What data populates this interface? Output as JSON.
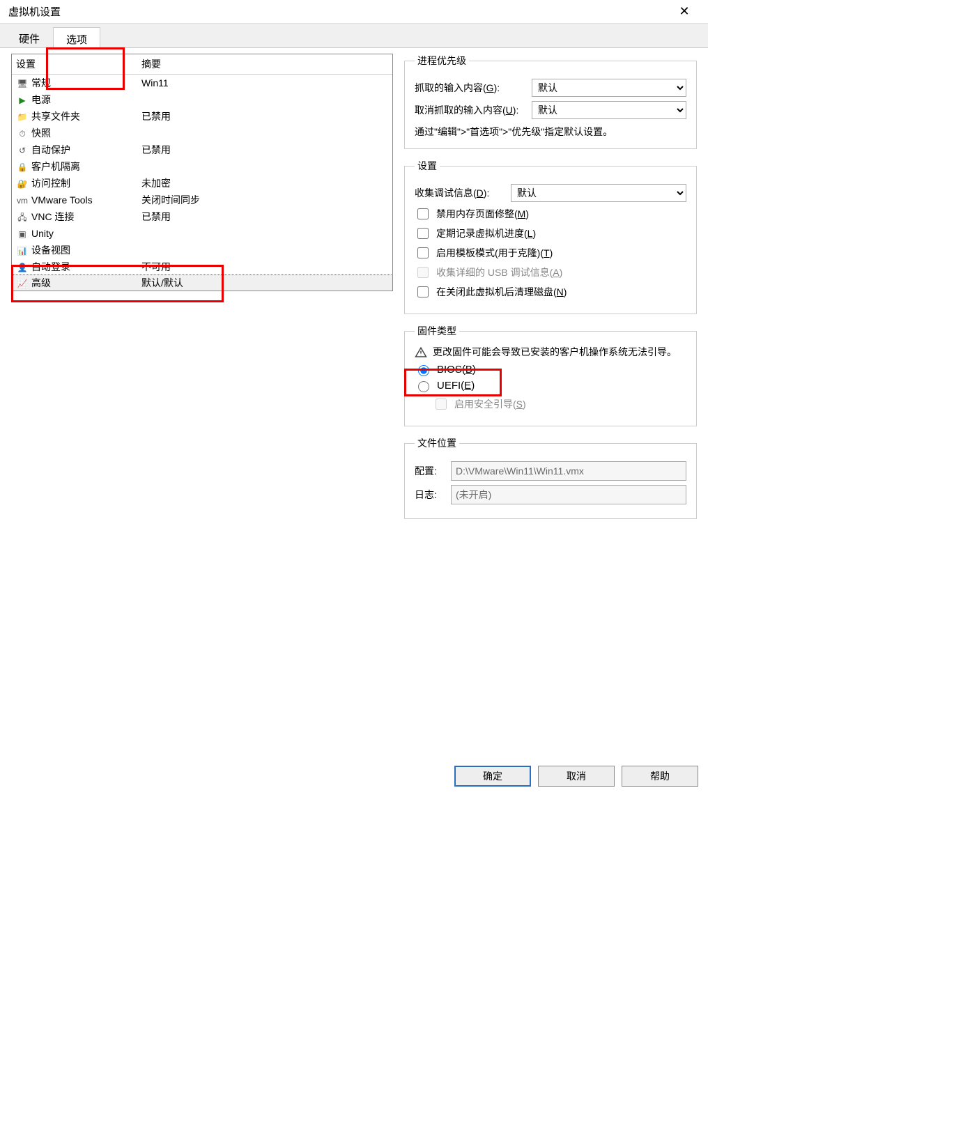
{
  "window": {
    "title": "虚拟机设置"
  },
  "tabs": {
    "hardware": "硬件",
    "options": "选项"
  },
  "left": {
    "header_setting": "设置",
    "header_summary": "摘要",
    "rows": [
      {
        "icon": "🖥",
        "label": "常规",
        "summary": "Win11"
      },
      {
        "icon": "▶",
        "label": "电源",
        "summary": ""
      },
      {
        "icon": "📁",
        "label": "共享文件夹",
        "summary": "已禁用"
      },
      {
        "icon": "⏱",
        "label": "快照",
        "summary": ""
      },
      {
        "icon": "↺",
        "label": "自动保护",
        "summary": "已禁用"
      },
      {
        "icon": "🔒",
        "label": "客户机隔离",
        "summary": ""
      },
      {
        "icon": "🔐",
        "label": "访问控制",
        "summary": "未加密"
      },
      {
        "icon": "vm",
        "label": "VMware Tools",
        "summary": "关闭时间同步"
      },
      {
        "icon": "🖧",
        "label": "VNC 连接",
        "summary": "已禁用"
      },
      {
        "icon": "▣",
        "label": "Unity",
        "summary": ""
      },
      {
        "icon": "📊",
        "label": "设备视图",
        "summary": ""
      },
      {
        "icon": "👤",
        "label": "自动登录",
        "summary": "不可用"
      },
      {
        "icon": "📈",
        "label": "高级",
        "summary": "默认/默认"
      }
    ]
  },
  "process_priority": {
    "legend": "进程优先级",
    "grabbed_label_prefix": "抓取的输入内容(",
    "grabbed_key": "G",
    "grabbed_label_suffix": "):",
    "grabbed_value": "默认",
    "ungrabbed_label_prefix": "取消抓取的输入内容(",
    "ungrabbed_key": "U",
    "ungrabbed_label_suffix": "):",
    "ungrabbed_value": "默认",
    "hint": "通过\"编辑\">\"首选项\">\"优先级\"指定默认设置。"
  },
  "settings": {
    "legend": "设置",
    "debug_label_prefix": "收集调试信息(",
    "debug_key": "D",
    "debug_label_suffix": "):",
    "debug_value": "默认",
    "checkboxes": {
      "disable_mem_prefix": "禁用内存页面修整(",
      "disable_mem_key": "M",
      "disable_mem_suffix": ")",
      "log_progress_prefix": "定期记录虚拟机进度(",
      "log_progress_key": "L",
      "log_progress_suffix": ")",
      "template_prefix": "启用模板模式(用于克隆)(",
      "template_key": "T",
      "template_suffix": ")",
      "usb_debug_prefix": "收集详细的 USB 调试信息(",
      "usb_debug_key": "A",
      "usb_debug_suffix": ")",
      "clean_disk_prefix": "在关闭此虚拟机后清理磁盘(",
      "clean_disk_key": "N",
      "clean_disk_suffix": ")"
    }
  },
  "firmware": {
    "legend": "固件类型",
    "warning": "更改固件可能会导致已安装的客户机操作系统无法引导。",
    "bios_prefix": "BIOS(",
    "bios_key": "B",
    "bios_suffix": ")",
    "uefi_prefix": "UEFI(",
    "uefi_key": "E",
    "uefi_suffix": ")",
    "secure_boot_prefix": "启用安全引导(",
    "secure_boot_key": "S",
    "secure_boot_suffix": ")"
  },
  "file_location": {
    "legend": "文件位置",
    "config_label": "配置:",
    "config_value": "D:\\VMware\\Win11\\Win11.vmx",
    "log_label": "日志:",
    "log_value": "(未开启)"
  },
  "buttons": {
    "ok": "确定",
    "cancel": "取消",
    "help": "帮助"
  }
}
